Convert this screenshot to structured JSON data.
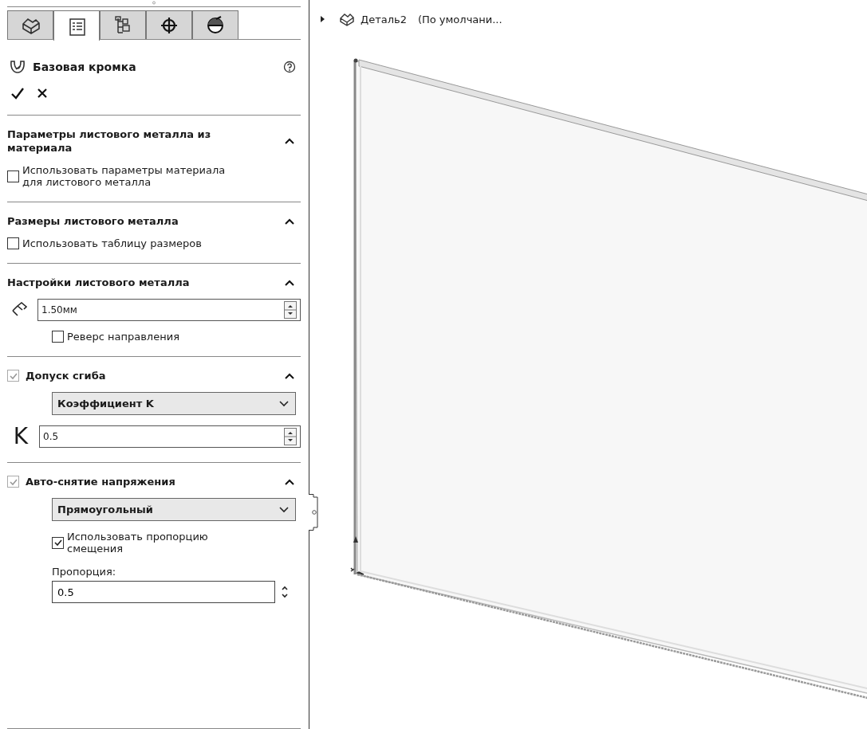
{
  "panel_tabs": [
    {
      "kind": "part",
      "selected": false
    },
    {
      "kind": "properties",
      "selected": true
    },
    {
      "kind": "configurations",
      "selected": false
    },
    {
      "kind": "dimensions",
      "selected": false
    },
    {
      "kind": "appearance",
      "selected": false
    }
  ],
  "feature": {
    "title": "Базовая кромка"
  },
  "sections": [
    {
      "title": "Параметры листового металла из материала",
      "expanded": true,
      "rows": [
        {
          "kind": "checkbox",
          "label": "Использовать параметры материала для листового металла",
          "checked": false
        }
      ]
    },
    {
      "title": "Размеры листового металла",
      "expanded": true,
      "rows": [
        {
          "kind": "checkbox",
          "label": "Использовать таблицу размеров",
          "checked": false
        }
      ]
    },
    {
      "title": "Настройки листового металла",
      "expanded": true,
      "rows": [
        {
          "kind": "thickness",
          "value": "1.50мм"
        },
        {
          "kind": "option",
          "label": "Реверс направления",
          "checked": false
        }
      ]
    },
    {
      "title": "Допуск сгиба",
      "expanded": true,
      "checked": true,
      "disabled": true,
      "rows": [
        {
          "kind": "dropdown",
          "value": "Коэффициент K"
        },
        {
          "kind": "letter-spin",
          "symbol": "K",
          "value": "0.5"
        }
      ]
    },
    {
      "title": "Авто-снятие напряжения",
      "expanded": true,
      "checked": true,
      "disabled": true,
      "rows": [
        {
          "kind": "dropdown",
          "value": "Прямоугольный"
        },
        {
          "kind": "option",
          "label": "Использовать пропорцию смещения",
          "checked": true
        },
        {
          "kind": "caption",
          "label": "Пропорция:"
        },
        {
          "kind": "ratio",
          "value": "0.5"
        }
      ]
    }
  ],
  "tree": {
    "expanded": false,
    "name": "Деталь2",
    "configuration": "(По умолчани..."
  }
}
